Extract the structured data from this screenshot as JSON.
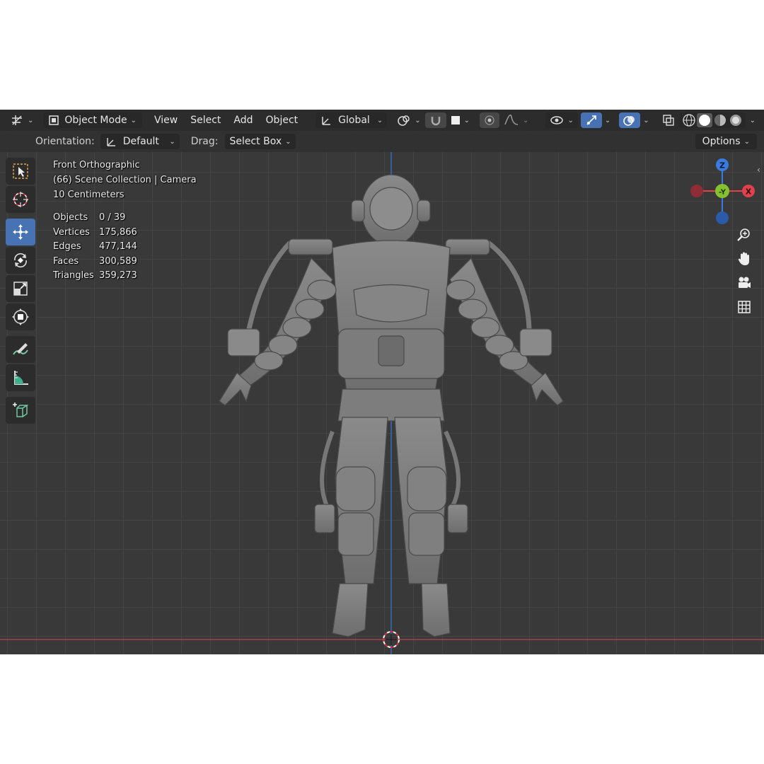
{
  "header": {
    "mode": "Object Mode",
    "menus": [
      "View",
      "Select",
      "Add",
      "Object"
    ],
    "transform_orientation": "Global"
  },
  "tool_header": {
    "orientation_label": "Orientation:",
    "orientation_value": "Default",
    "drag_label": "Drag:",
    "drag_value": "Select Box",
    "options_label": "Options"
  },
  "overlay": {
    "view_name": "Front Orthographic",
    "collection": "(66) Scene Collection | Camera",
    "grid_scale": "10 Centimeters",
    "stats": [
      {
        "label": "Objects",
        "value": "0 / 39"
      },
      {
        "label": "Vertices",
        "value": "175,866"
      },
      {
        "label": "Edges",
        "value": "477,144"
      },
      {
        "label": "Faces",
        "value": "300,589"
      },
      {
        "label": "Triangles",
        "value": "359,273"
      }
    ]
  },
  "gizmo": {
    "z": "Z",
    "y": "-Y",
    "x": "X"
  },
  "colors": {
    "accent": "#4772b3",
    "axis_x": "#e0424c",
    "axis_y": "#85c22f",
    "axis_z": "#3a7be0",
    "background": "#393939"
  },
  "tools": [
    "select-box-icon",
    "cursor-icon",
    "move-icon",
    "rotate-icon",
    "scale-icon",
    "transform-icon",
    "annotate-icon",
    "measure-icon",
    "add-cube-icon"
  ]
}
